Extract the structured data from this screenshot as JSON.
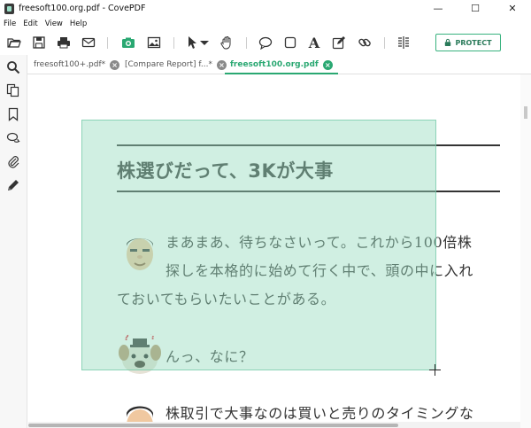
{
  "window": {
    "title": "freesoft100.org.pdf - CovePDF",
    "controls": {
      "minimize": "—",
      "maximize": "☐",
      "close": "✕"
    }
  },
  "menu": [
    "File",
    "Edit",
    "View",
    "Help"
  ],
  "toolbar": {
    "protect_label": "PROTECT",
    "accent_color": "#2aa872",
    "icons": [
      "open-folder-icon",
      "save-icon",
      "print-icon",
      "email-icon",
      "camera-icon",
      "image-icon",
      "select-arrow-icon",
      "hand-icon",
      "comment-icon",
      "rectangle-icon",
      "text-icon",
      "edit-icon",
      "link-icon",
      "compare-icon"
    ]
  },
  "sidebar": {
    "icons": [
      "search-icon",
      "pages-icon",
      "bookmark-icon",
      "comments-icon",
      "attachment-icon",
      "pen-icon"
    ]
  },
  "tabs": [
    {
      "label": "freesoft100+.pdf*",
      "active": false
    },
    {
      "label": "[Compare Report] f...*",
      "active": false
    },
    {
      "label": "freesoft100.org.pdf",
      "active": true
    }
  ],
  "document": {
    "heading": "株選びだって、3Kが大事",
    "paragraph1": [
      "まあまあ、待ちなさいって。これから100倍株",
      "探しを本格的に始めて行く中で、頭の中に入れ",
      "ておいてもらいたいことがある。"
    ],
    "paragraph2": "んっ、なに？",
    "paragraph3": "株取引で大事なのは買いと売りのタイミングな"
  }
}
